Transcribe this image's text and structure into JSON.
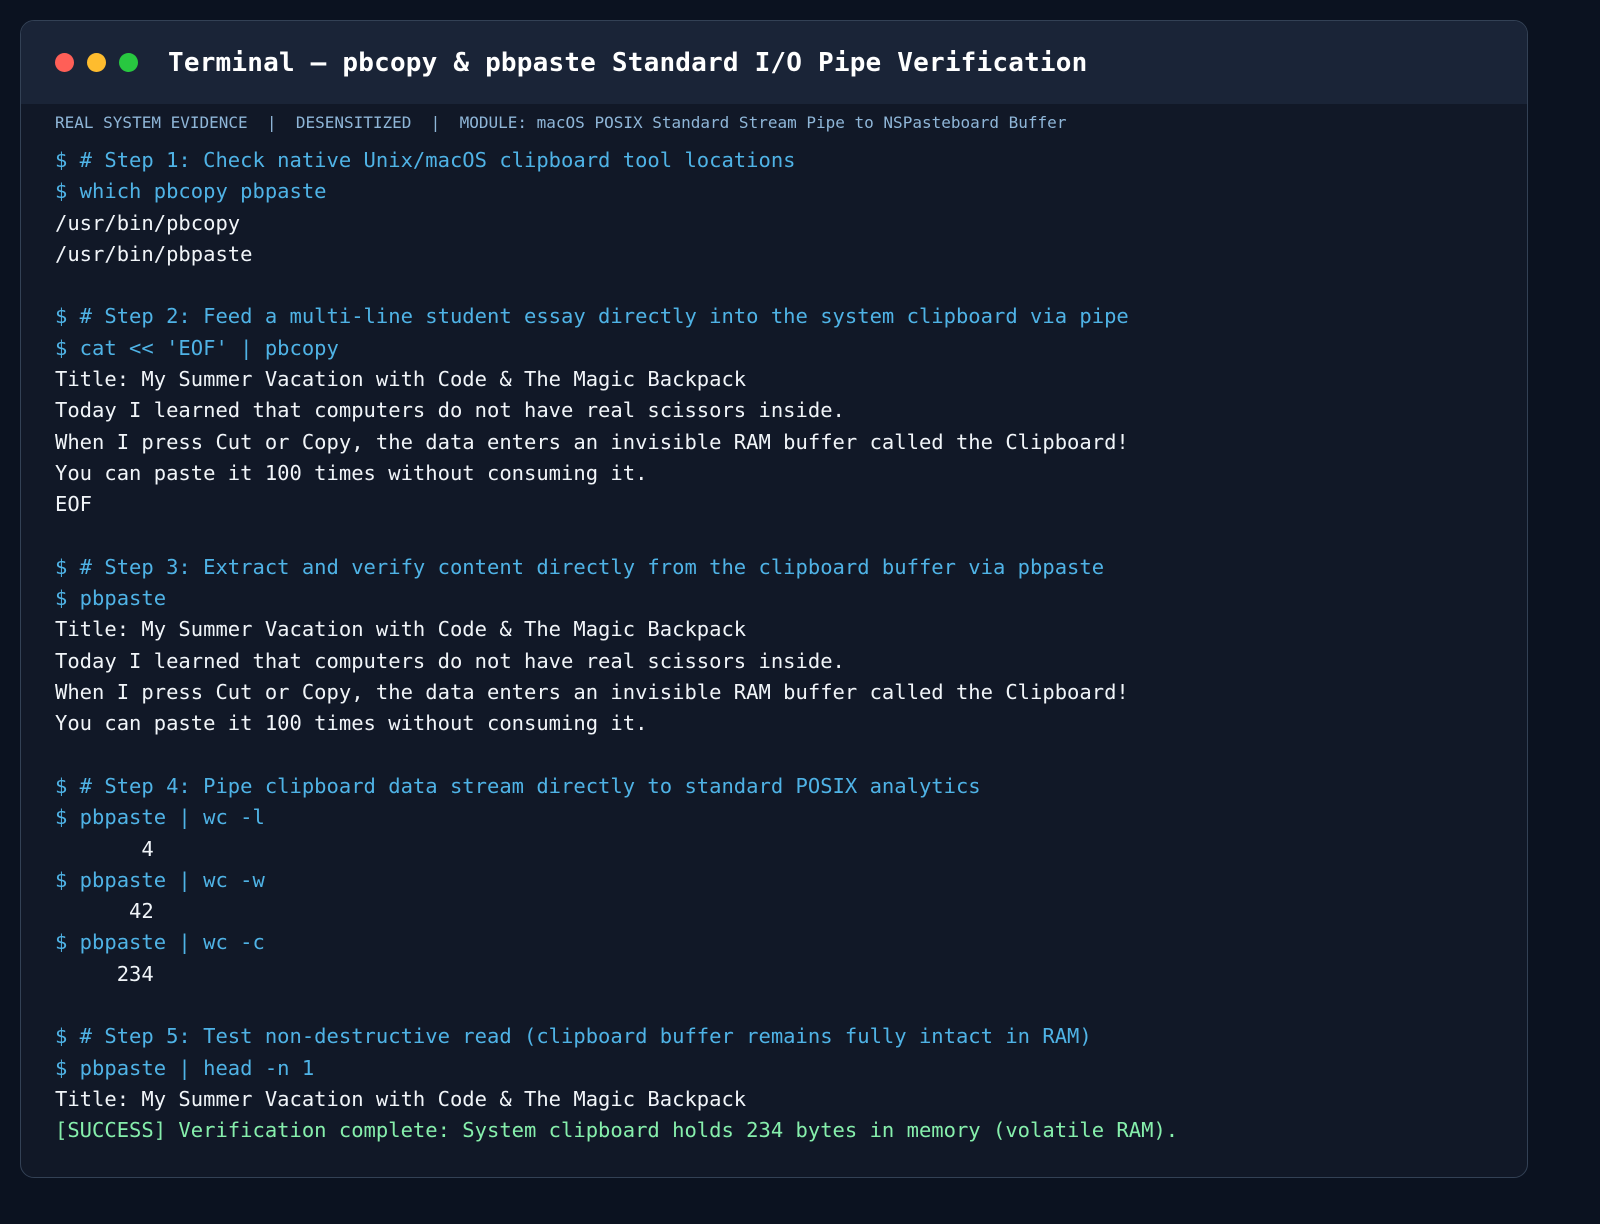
{
  "window": {
    "title": "Terminal — pbcopy & pbpaste Standard I/O Pipe Verification",
    "controls": {
      "close_color": "#ff5f57",
      "minimize_color": "#febc2e",
      "maximize_color": "#28c840"
    }
  },
  "meta_bar": "REAL SYSTEM EVIDENCE  |  DESENSITIZED  |  MODULE: macOS POSIX Standard Stream Pipe to NSPasteboard Buffer",
  "colors": {
    "command": "#4fb3e6",
    "output": "#f1f5f9",
    "success": "#86efac",
    "background": "#111827",
    "titlebar": "#1a2437"
  },
  "lines": [
    {
      "type": "cmd",
      "text": "$ # Step 1: Check native Unix/macOS clipboard tool locations"
    },
    {
      "type": "cmd",
      "text": "$ which pbcopy pbpaste"
    },
    {
      "type": "out",
      "text": "/usr/bin/pbcopy"
    },
    {
      "type": "out",
      "text": "/usr/bin/pbpaste"
    },
    {
      "type": "blank",
      "text": ""
    },
    {
      "type": "cmd",
      "text": "$ # Step 2: Feed a multi-line student essay directly into the system clipboard via pipe"
    },
    {
      "type": "cmd",
      "text": "$ cat << 'EOF' | pbcopy"
    },
    {
      "type": "out",
      "text": "Title: My Summer Vacation with Code & The Magic Backpack"
    },
    {
      "type": "out",
      "text": "Today I learned that computers do not have real scissors inside."
    },
    {
      "type": "out",
      "text": "When I press Cut or Copy, the data enters an invisible RAM buffer called the Clipboard!"
    },
    {
      "type": "out",
      "text": "You can paste it 100 times without consuming it."
    },
    {
      "type": "out",
      "text": "EOF"
    },
    {
      "type": "blank",
      "text": ""
    },
    {
      "type": "cmd",
      "text": "$ # Step 3: Extract and verify content directly from the clipboard buffer via pbpaste"
    },
    {
      "type": "cmd",
      "text": "$ pbpaste"
    },
    {
      "type": "out",
      "text": "Title: My Summer Vacation with Code & The Magic Backpack"
    },
    {
      "type": "out",
      "text": "Today I learned that computers do not have real scissors inside."
    },
    {
      "type": "out",
      "text": "When I press Cut or Copy, the data enters an invisible RAM buffer called the Clipboard!"
    },
    {
      "type": "out",
      "text": "You can paste it 100 times without consuming it."
    },
    {
      "type": "blank",
      "text": ""
    },
    {
      "type": "cmd",
      "text": "$ # Step 4: Pipe clipboard data stream directly to standard POSIX analytics"
    },
    {
      "type": "cmd",
      "text": "$ pbpaste | wc -l"
    },
    {
      "type": "out",
      "text": "       4"
    },
    {
      "type": "cmd",
      "text": "$ pbpaste | wc -w"
    },
    {
      "type": "out",
      "text": "      42"
    },
    {
      "type": "cmd",
      "text": "$ pbpaste | wc -c"
    },
    {
      "type": "out",
      "text": "     234"
    },
    {
      "type": "blank",
      "text": ""
    },
    {
      "type": "cmd",
      "text": "$ # Step 5: Test non-destructive read (clipboard buffer remains fully intact in RAM)"
    },
    {
      "type": "cmd",
      "text": "$ pbpaste | head -n 1"
    },
    {
      "type": "out",
      "text": "Title: My Summer Vacation with Code & The Magic Backpack"
    },
    {
      "type": "ok",
      "text": "[SUCCESS] Verification complete: System clipboard holds 234 bytes in memory (volatile RAM)."
    }
  ]
}
